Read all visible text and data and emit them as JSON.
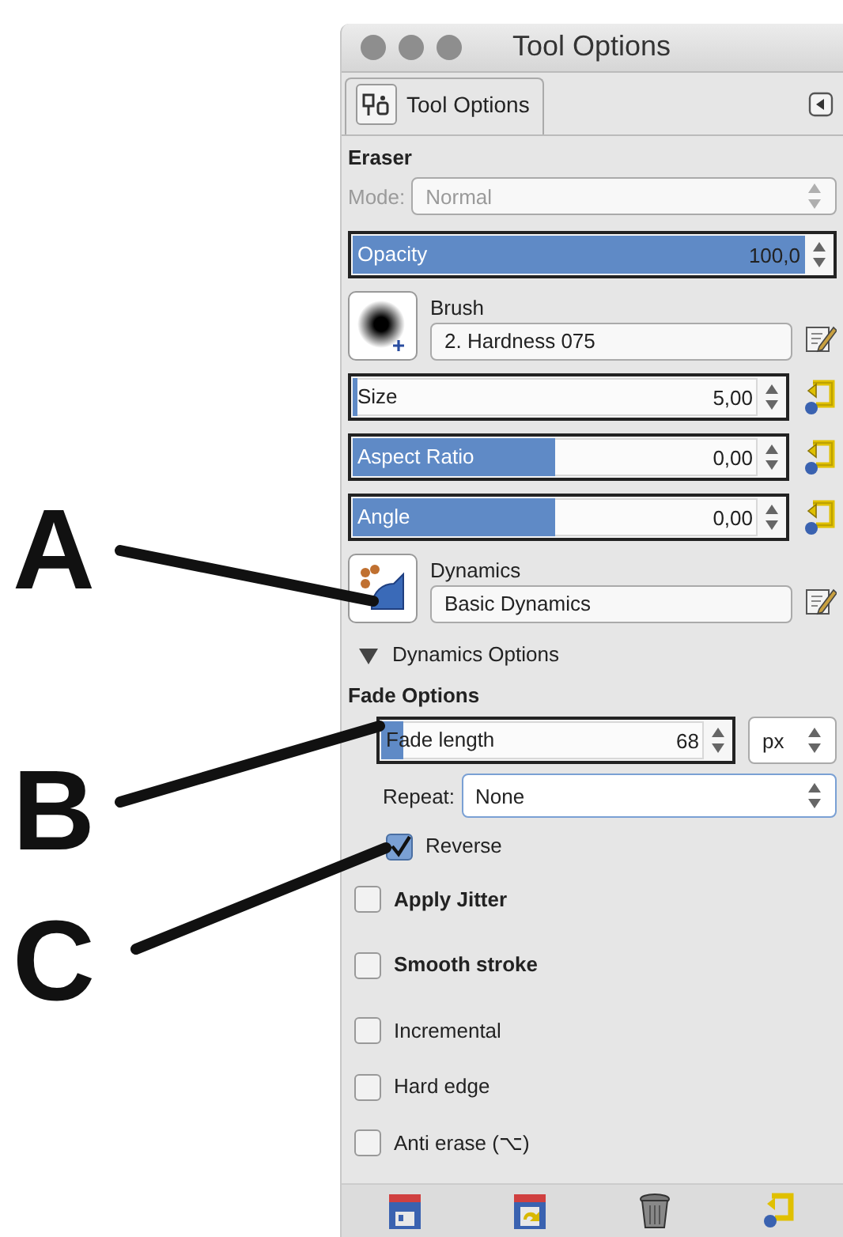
{
  "window": {
    "title": "Tool Options"
  },
  "tab": {
    "label": "Tool Options",
    "selected": true
  },
  "tool_name": "Eraser",
  "mode": {
    "label": "Mode:",
    "value": "Normal",
    "disabled": true
  },
  "controls": [
    {
      "kind": "slider",
      "label": "Opacity",
      "value": "100,0",
      "level": 1.0,
      "reset": false
    },
    {
      "kind": "resource",
      "label": "Brush",
      "value": "2. Hardness 075"
    },
    {
      "kind": "slider",
      "label": "Size",
      "value": "5,00",
      "level": 0.01,
      "reset": true
    },
    {
      "kind": "slider",
      "label": "Aspect Ratio",
      "value": "0,00",
      "level": 0.5,
      "reset": true
    },
    {
      "kind": "slider",
      "label": "Angle",
      "value": "0,00",
      "level": 0.5,
      "reset": true
    },
    {
      "kind": "resource",
      "label": "Dynamics",
      "value": "Basic Dynamics"
    }
  ],
  "dynamics_options": {
    "label": "Dynamics Options",
    "expanded": true
  },
  "fade_options": {
    "title": "Fade Options",
    "length": {
      "label": "Fade length",
      "value": "68",
      "level": 0.07,
      "unit": "px"
    },
    "repeat": {
      "label": "Repeat:",
      "value": "None"
    },
    "reverse": {
      "label": "Reverse",
      "checked": true
    }
  },
  "options": [
    {
      "label": "Apply Jitter",
      "checked": false,
      "kind": "heading"
    },
    {
      "label": "Smooth stroke",
      "checked": false,
      "kind": "heading"
    },
    {
      "label": "Incremental",
      "checked": false,
      "kind": "plain"
    },
    {
      "label": "Hard edge",
      "checked": false,
      "kind": "plain"
    },
    {
      "label": "Anti erase  (⌥)",
      "checked": false,
      "kind": "plain"
    }
  ],
  "footer_buttons": [
    {
      "kind": "save"
    },
    {
      "kind": "restore"
    },
    {
      "kind": "delete"
    },
    {
      "kind": "reset"
    }
  ],
  "annotations": [
    {
      "label": "A"
    },
    {
      "label": "B"
    },
    {
      "label": "C"
    }
  ]
}
